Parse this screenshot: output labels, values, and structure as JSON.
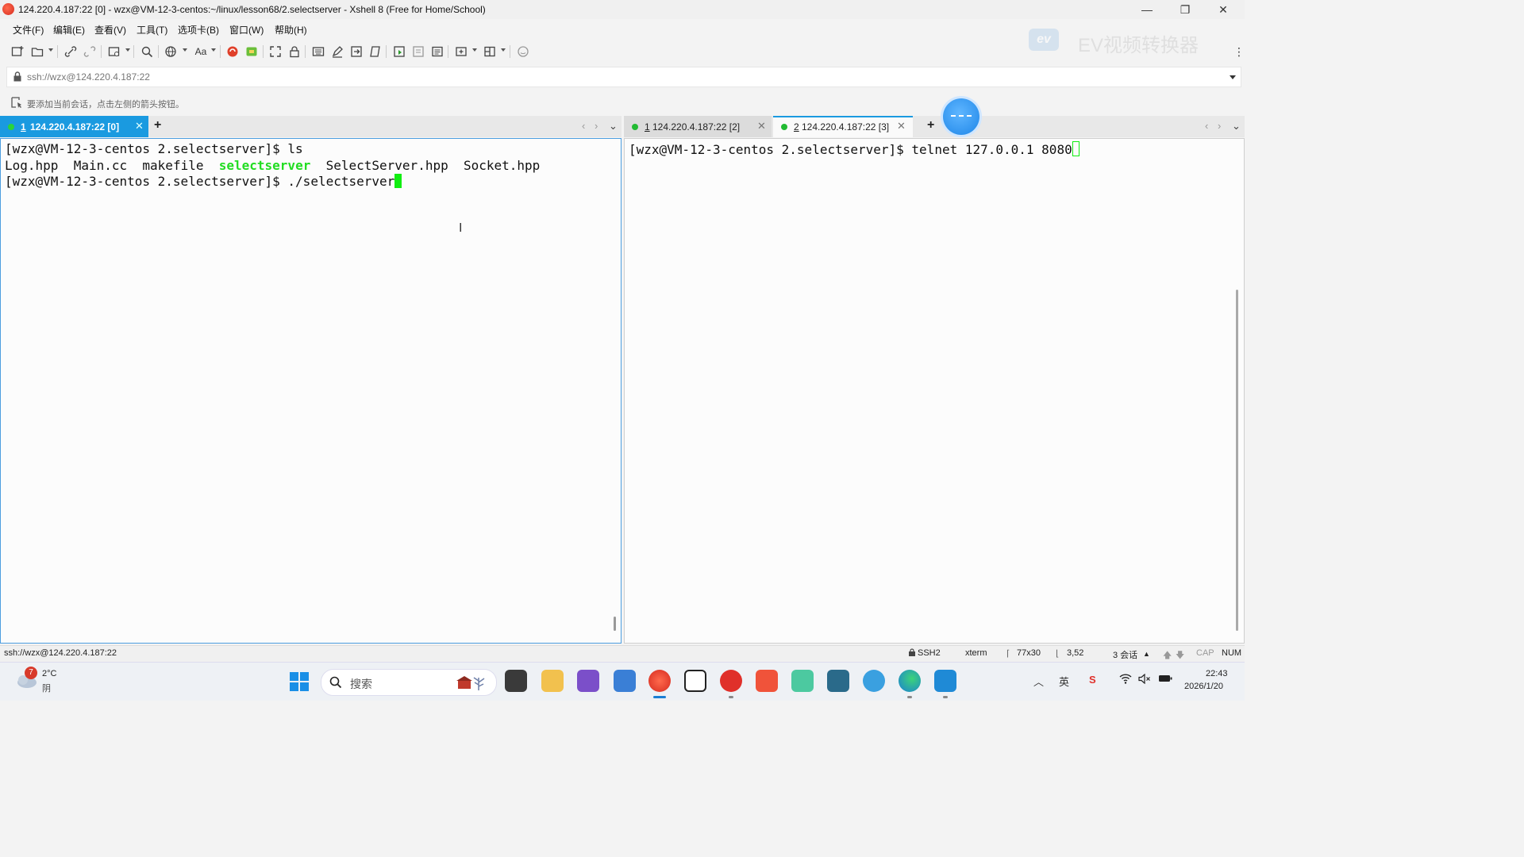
{
  "window": {
    "title": "124.220.4.187:22 [0] - wzx@VM-12-3-centos:~/linux/lesson68/2.selectserver - Xshell 8 (Free for Home/School)",
    "minimize_glyph": "—",
    "restore_glyph": "❐",
    "close_glyph": "✕"
  },
  "menu": [
    "文件(F)",
    "编辑(E)",
    "查看(V)",
    "工具(T)",
    "选项卡(B)",
    "窗口(W)",
    "帮助(H)"
  ],
  "toolbar": {
    "font_label": "Aa",
    "more_glyph": "⋮"
  },
  "watermark": {
    "logo": "ev",
    "text": "EV视频转换器"
  },
  "address": {
    "value": "ssh://wzx@124.220.4.187:22"
  },
  "hint": {
    "text": "要添加当前会话，点击左侧的箭头按钮。"
  },
  "tabs_left": [
    {
      "num": "1",
      "label": "124.220.4.187:22 [0]"
    }
  ],
  "tabs_right": [
    {
      "num": "1",
      "label": "124.220.4.187:22 [2]"
    },
    {
      "num": "2",
      "label": "124.220.4.187:22 [3]"
    }
  ],
  "tab_controls": {
    "add": "+",
    "close": "✕",
    "prev": "‹",
    "next": "›",
    "menu": "⌄"
  },
  "terminal_left": {
    "line1": "[wzx@VM-12-3-centos 2.selectserver]$ ls",
    "line2_files": [
      "Log.hpp",
      "Main.cc",
      "makefile",
      "selectserver",
      "SelectServer.hpp",
      "Socket.hpp"
    ],
    "line2_sep": "  ",
    "line3": "[wzx@VM-12-3-centos 2.selectserver]$ ./selectserver",
    "text_cursor": "I"
  },
  "terminal_right": {
    "line1": "[wzx@VM-12-3-centos 2.selectserver]$ telnet 127.0.0.1 8080"
  },
  "statusbar": {
    "address": "ssh://wzx@124.220.4.187:22",
    "protocol": "SSH2",
    "term": "xterm",
    "size": "77x30",
    "cursor": "3,52",
    "sessions": "3 会话",
    "cap": "CAP",
    "num": "NUM"
  },
  "taskbar": {
    "weather_temp": "2°C",
    "weather_desc": "阴",
    "weather_badge": "7",
    "search_placeholder": "搜索",
    "time": "22:43",
    "date": "2026/1/20",
    "ime": "英"
  },
  "colors": {
    "accent": "#1a9ae0",
    "terminal_green": "#22dd22",
    "pane_border_active": "#4d9ee0"
  }
}
